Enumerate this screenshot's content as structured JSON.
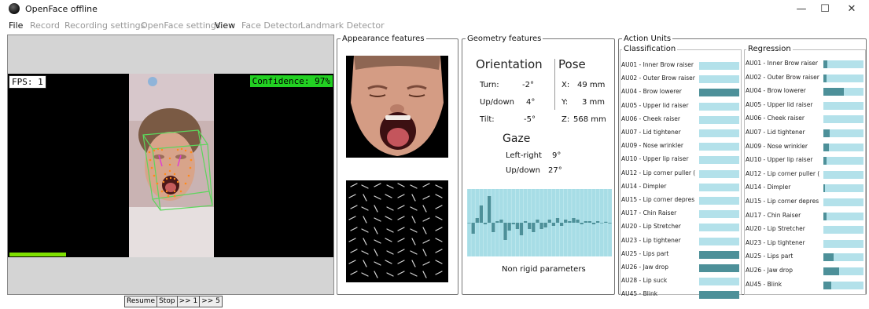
{
  "window": {
    "title": "OpenFace offline",
    "controls": {
      "minimize": "—",
      "maximize": "☐",
      "close": "✕"
    }
  },
  "menu": [
    {
      "label": "File",
      "enabled": true
    },
    {
      "label": "Record",
      "enabled": false
    },
    {
      "label": "Recording settings",
      "enabled": false
    },
    {
      "label": "OpenFace settings",
      "enabled": false
    },
    {
      "label": "View",
      "enabled": true
    },
    {
      "label": "Face Detector",
      "enabled": false
    },
    {
      "label": "Landmark Detector",
      "enabled": false
    }
  ],
  "video": {
    "fps": "FPS: 1",
    "confidence": "Confidence: 97%",
    "colors": {
      "confidence_bg": "#22d122",
      "progress": "#7ee000"
    }
  },
  "controls": [
    "Resume",
    "Stop",
    ">> 1",
    ">> 5"
  ],
  "appearance": {
    "title": "Appearance features"
  },
  "geometry": {
    "title": "Geometry features",
    "orientation_title": "Orientation",
    "pose_title": "Pose",
    "turn_label": "Turn:",
    "turn_value": "-2°",
    "updown_label": "Up/down",
    "updown_value": "4°",
    "tilt_label": "Tilt:",
    "tilt_value": "-5°",
    "x_label": "X:",
    "x_value": "49 mm",
    "y_label": "Y:",
    "y_value": "3 mm",
    "z_label": "Z:",
    "z_value": "568 mm",
    "gaze_title": "Gaze",
    "gaze_lr_label": "Left-right",
    "gaze_lr_value": "9°",
    "gaze_ud_label": "Up/down",
    "gaze_ud_value": "27°",
    "nonrigid_label": "Non rigid parameters",
    "nonrigid_values": [
      0.0,
      -0.35,
      0.15,
      0.55,
      -0.05,
      0.85,
      -0.3,
      0.05,
      0.1,
      -0.55,
      -0.25,
      -0.05,
      -0.2,
      -0.4,
      0.05,
      -0.2,
      -0.3,
      0.1,
      -0.2,
      -0.15,
      0.1,
      -0.1,
      0.15,
      -0.1,
      0.1,
      0.05,
      0.15,
      0.1,
      -0.05,
      0.05,
      0.05,
      -0.05,
      0.05,
      0.0,
      0.03,
      -0.02
    ],
    "colors": {
      "bar_bg": "#a7dde6",
      "bar_fill": "#4d9099"
    }
  },
  "action_units": {
    "title": "Action Units",
    "classification_title": "Classification",
    "regression_title": "Regression",
    "classification": [
      {
        "label": "AU01 - Inner Brow raiser",
        "value": 0
      },
      {
        "label": "AU02 - Outer Brow raiser",
        "value": 0
      },
      {
        "label": "AU04 - Brow lowerer",
        "value": 1
      },
      {
        "label": "AU05 - Upper lid raiser",
        "value": 0
      },
      {
        "label": "AU06 - Cheek raiser",
        "value": 0
      },
      {
        "label": "AU07 - Lid tightener",
        "value": 0
      },
      {
        "label": "AU09 - Nose wrinkler",
        "value": 0
      },
      {
        "label": "AU10 - Upper lip raiser",
        "value": 0
      },
      {
        "label": "AU12 - Lip corner puller (",
        "value": 0
      },
      {
        "label": "AU14 - Dimpler",
        "value": 0
      },
      {
        "label": "AU15 - Lip corner depres",
        "value": 0
      },
      {
        "label": "AU17 - Chin Raiser",
        "value": 0
      },
      {
        "label": "AU20 - Lip Stretcher",
        "value": 0
      },
      {
        "label": "AU23 - Lip tightener",
        "value": 0
      },
      {
        "label": "AU25 - Lips part",
        "value": 1
      },
      {
        "label": "AU26 - Jaw drop",
        "value": 1
      },
      {
        "label": "AU28 - Lip suck",
        "value": 0
      },
      {
        "label": "AU45 - Blink",
        "value": 1
      }
    ],
    "regression": [
      {
        "label": "AU01 - Inner Brow raiser",
        "value": 0.1
      },
      {
        "label": "AU02 - Outer Brow raiser",
        "value": 0.08
      },
      {
        "label": "AU04 - Brow lowerer",
        "value": 0.5
      },
      {
        "label": "AU05 - Upper lid raiser",
        "value": 0
      },
      {
        "label": "AU06 - Cheek raiser",
        "value": 0
      },
      {
        "label": "AU07 - Lid tightener",
        "value": 0.16
      },
      {
        "label": "AU09 - Nose wrinkler",
        "value": 0.14
      },
      {
        "label": "AU10 - Upper lip raiser",
        "value": 0.08
      },
      {
        "label": "AU12 - Lip corner puller (",
        "value": 0
      },
      {
        "label": "AU14 - Dimpler",
        "value": 0.04
      },
      {
        "label": "AU15 - Lip corner depres",
        "value": 0
      },
      {
        "label": "AU17 - Chin Raiser",
        "value": 0.08
      },
      {
        "label": "AU20 - Lip Stretcher",
        "value": 0
      },
      {
        "label": "AU23 - Lip tightener",
        "value": 0
      },
      {
        "label": "AU25 - Lips part",
        "value": 0.25
      },
      {
        "label": "AU26 - Jaw drop",
        "value": 0.4
      },
      {
        "label": "AU45 - Blink",
        "value": 0.2
      }
    ],
    "colors": {
      "bar_bg": "#b3e1ea",
      "bar_fill": "#4d9099"
    }
  }
}
